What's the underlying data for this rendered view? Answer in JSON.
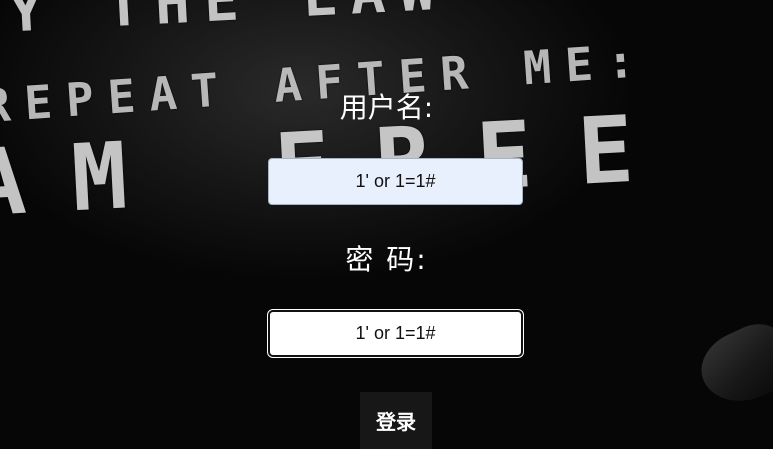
{
  "background": {
    "line1": "Y THE LAW",
    "line2": "REPEAT AFTER ME:",
    "line3": "AM FREE"
  },
  "form": {
    "username_label": "用户名:",
    "username_value": "1' or 1=1#",
    "password_label": "密 码:",
    "password_value": "1' or 1=1#",
    "login_label": "登录"
  },
  "colors": {
    "autofill_bg": "#e8f0fe",
    "button_bg": "#171717",
    "label_text": "#ffffff"
  }
}
